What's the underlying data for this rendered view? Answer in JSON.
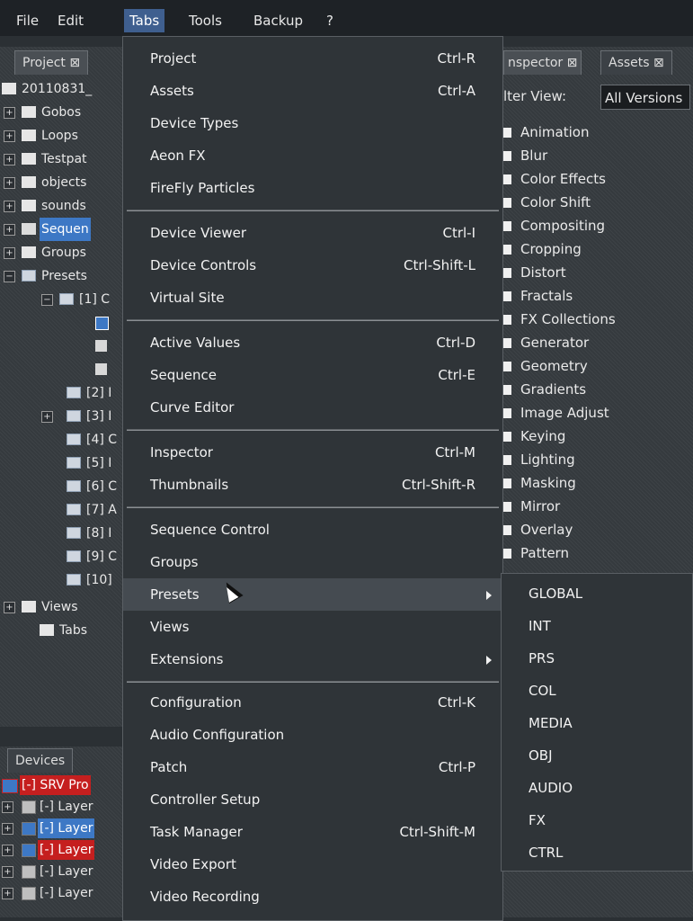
{
  "menubar": {
    "items": [
      "File",
      "Edit",
      "Tabs",
      "Tools",
      "Backup",
      "?"
    ]
  },
  "left_panel": {
    "tab": "Project ⊠",
    "tree": [
      {
        "label": "20110831_"
      },
      {
        "label": "Gobos"
      },
      {
        "label": "Loops"
      },
      {
        "label": "Testpat"
      },
      {
        "label": "objects"
      },
      {
        "label": "sounds"
      },
      {
        "label": "Sequen"
      },
      {
        "label": "Groups"
      },
      {
        "label": "Presets"
      },
      {
        "label": "[1] C"
      },
      {
        "label": "[2] I"
      },
      {
        "label": "[3] I"
      },
      {
        "label": "[4] C"
      },
      {
        "label": "[5] I"
      },
      {
        "label": "[6] C"
      },
      {
        "label": "[7] A"
      },
      {
        "label": "[8] I"
      },
      {
        "label": "[9] C"
      },
      {
        "label": "[10]"
      },
      {
        "label": "Views"
      },
      {
        "label": "Tabs"
      }
    ]
  },
  "devices_panel": {
    "tab": "Devices",
    "rows": [
      {
        "label": "[-] SRV Pro"
      },
      {
        "label": "[-] Layer"
      },
      {
        "label": "[-] Layer"
      },
      {
        "label": "[-] Layer"
      },
      {
        "label": "[-] Layer"
      },
      {
        "label": "[-] Layer"
      }
    ]
  },
  "right_panel": {
    "tabs": [
      "nspector ⊠",
      "Assets ⊠"
    ],
    "filter_label": "lter View:",
    "filter_value": "All Versions",
    "categories": [
      "Animation",
      "Blur",
      "Color Effects",
      "Color Shift",
      "Compositing",
      "Cropping",
      "Distort",
      "Fractals",
      "FX Collections",
      "Generator",
      "Geometry",
      "Gradients",
      "Image Adjust",
      "Keying",
      "Lighting",
      "Masking",
      "Mirror",
      "Overlay",
      "Pattern"
    ]
  },
  "tabs_menu": {
    "items": [
      {
        "label": "Project",
        "shortcut": "Ctrl-R"
      },
      {
        "label": "Assets",
        "shortcut": "Ctrl-A"
      },
      {
        "label": "Device Types",
        "shortcut": ""
      },
      {
        "label": "Aeon FX",
        "shortcut": ""
      },
      {
        "label": "FireFly Particles",
        "shortcut": ""
      },
      {
        "label": "Device Viewer",
        "shortcut": "Ctrl-I"
      },
      {
        "label": "Device Controls",
        "shortcut": "Ctrl-Shift-L"
      },
      {
        "label": "Virtual Site",
        "shortcut": ""
      },
      {
        "label": "Active Values",
        "shortcut": "Ctrl-D"
      },
      {
        "label": "Sequence",
        "shortcut": "Ctrl-E"
      },
      {
        "label": "Curve Editor",
        "shortcut": ""
      },
      {
        "label": "Inspector",
        "shortcut": "Ctrl-M"
      },
      {
        "label": "Thumbnails",
        "shortcut": "Ctrl-Shift-R"
      },
      {
        "label": "Sequence Control",
        "shortcut": ""
      },
      {
        "label": "Groups",
        "shortcut": ""
      },
      {
        "label": "Presets",
        "shortcut": ""
      },
      {
        "label": "Views",
        "shortcut": ""
      },
      {
        "label": "Extensions",
        "shortcut": ""
      },
      {
        "label": "Configuration",
        "shortcut": "Ctrl-K"
      },
      {
        "label": "Audio Configuration",
        "shortcut": ""
      },
      {
        "label": "Patch",
        "shortcut": "Ctrl-P"
      },
      {
        "label": "Controller Setup",
        "shortcut": ""
      },
      {
        "label": "Task Manager",
        "shortcut": "Ctrl-Shift-M"
      },
      {
        "label": "Video Export",
        "shortcut": ""
      },
      {
        "label": "Video Recording",
        "shortcut": ""
      }
    ]
  },
  "presets_submenu": {
    "items": [
      "GLOBAL",
      "INT",
      "PRS",
      "COL",
      "MEDIA",
      "OBJ",
      "AUDIO",
      "FX",
      "CTRL"
    ]
  }
}
